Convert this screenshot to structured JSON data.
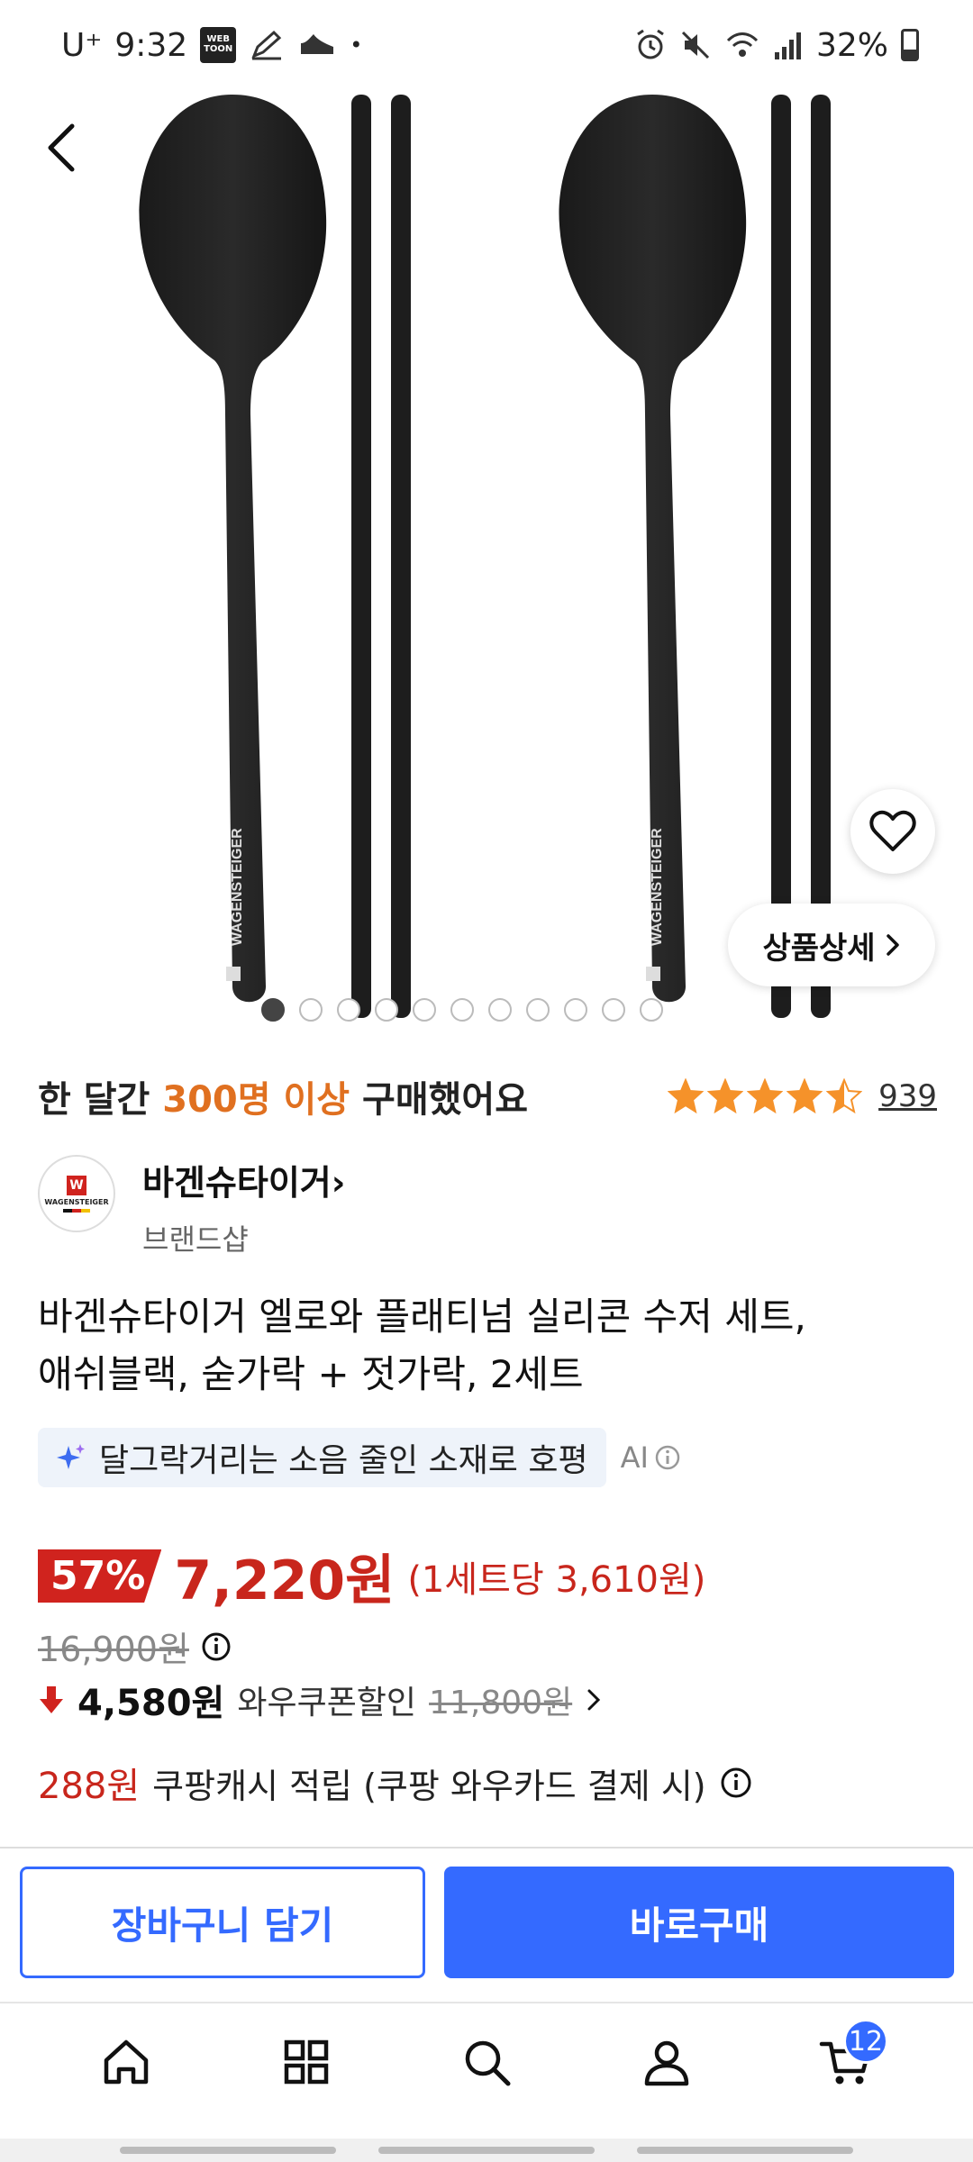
{
  "status_bar": {
    "carrier": "U⁺",
    "time": "9:32",
    "webtoon_label": "WEB TOON",
    "battery": "32%"
  },
  "hero": {
    "detail_label": "상품상세",
    "brand_print": "WAGENSTEIGER",
    "total_images": 11,
    "current_image": 1
  },
  "purchase": {
    "prefix": "한 달간 ",
    "highlight": "300명 이상",
    "suffix": " 구매했어요",
    "rating": 4.5,
    "review_count": "939"
  },
  "brand": {
    "name": "바겐슈타이거",
    "chevron": "›",
    "subtitle": "브랜드샵",
    "logo_text": "WAGENSTEIGER"
  },
  "product": {
    "title_line1": "바겐슈타이거 엘로와 플래티넘 실리콘 수저 세트,",
    "title_line2": "애쉬블랙, 숟가락 + 젓가락, 2세트"
  },
  "ai_summary": {
    "text": "달그락거리는 소음 줄인 소재로 호평",
    "label": "AI"
  },
  "price": {
    "discount": "57%",
    "sale_price": "7,220원",
    "unit_price": "(1세트당 3,610원)",
    "original_price": "16,900원",
    "coupon_price": "4,580원",
    "coupon_label": "와우쿠폰할인",
    "coupon_original": "11,800원",
    "cash_amount": "288원",
    "cash_text": "쿠팡캐시 적립 (쿠팡 와우카드 결제 시)"
  },
  "actions": {
    "cart": "장바구니 담기",
    "buy": "바로구매"
  },
  "nav": {
    "cart_badge": "12"
  },
  "colors": {
    "accent_blue": "#346aff",
    "price_red": "#c8261c",
    "highlight_orange": "#e07020",
    "star_orange": "#f5922a"
  }
}
